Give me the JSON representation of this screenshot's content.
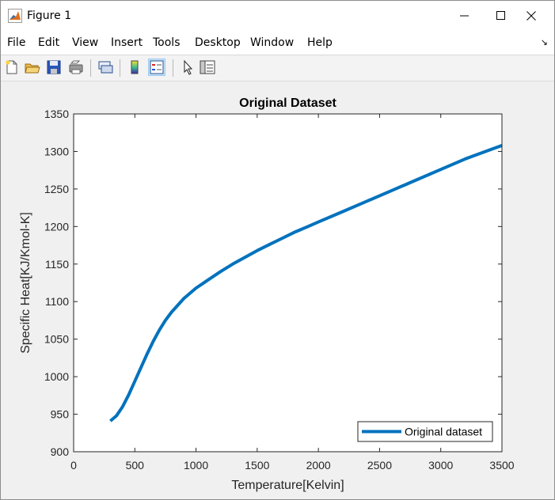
{
  "window": {
    "title": "Figure 1",
    "icons": {
      "app": "matlab-icon",
      "minimize": "minimize-icon",
      "maximize": "maximize-icon",
      "close": "close-icon"
    }
  },
  "menu": {
    "items": [
      "File",
      "Edit",
      "View",
      "Insert",
      "Tools",
      "Desktop",
      "Window",
      "Help"
    ],
    "overflow_arrow": "↘"
  },
  "toolbar": {
    "buttons": [
      "new-figure-icon",
      "open-file-icon",
      "save-icon",
      "print-icon",
      "link-plot-icon",
      "colorbar-icon",
      "legend-icon",
      "pointer-icon",
      "property-inspector-icon"
    ],
    "pressed": "legend-icon"
  },
  "chart_data": {
    "type": "line",
    "title": "Original Dataset",
    "xlabel": "Temperature[Kelvin]",
    "ylabel": "Specific Heat[KJ/Kmol-K]",
    "xlim": [
      0,
      3500
    ],
    "ylim": [
      900,
      1350
    ],
    "xticks": [
      0,
      500,
      1000,
      1500,
      2000,
      2500,
      3000,
      3500
    ],
    "yticks": [
      900,
      950,
      1000,
      1050,
      1100,
      1150,
      1200,
      1250,
      1300,
      1350
    ],
    "grid": false,
    "legend_position": "bottom-right",
    "colors": {
      "line": "#0072bd",
      "axes": "#262626"
    },
    "series": [
      {
        "name": "Original dataset",
        "x": [
          300,
          350,
          400,
          450,
          500,
          550,
          600,
          650,
          700,
          750,
          800,
          900,
          1000,
          1100,
          1200,
          1300,
          1400,
          1500,
          1600,
          1700,
          1800,
          1900,
          2000,
          2200,
          2400,
          2600,
          2800,
          3000,
          3200,
          3400,
          3500
        ],
        "y": [
          941,
          948,
          960,
          976,
          994,
          1012,
          1030,
          1047,
          1062,
          1075,
          1086,
          1104,
          1118,
          1129,
          1140,
          1150,
          1159,
          1168,
          1176,
          1184,
          1192,
          1199,
          1206,
          1220,
          1234,
          1248,
          1262,
          1276,
          1290,
          1302,
          1308
        ]
      }
    ]
  }
}
